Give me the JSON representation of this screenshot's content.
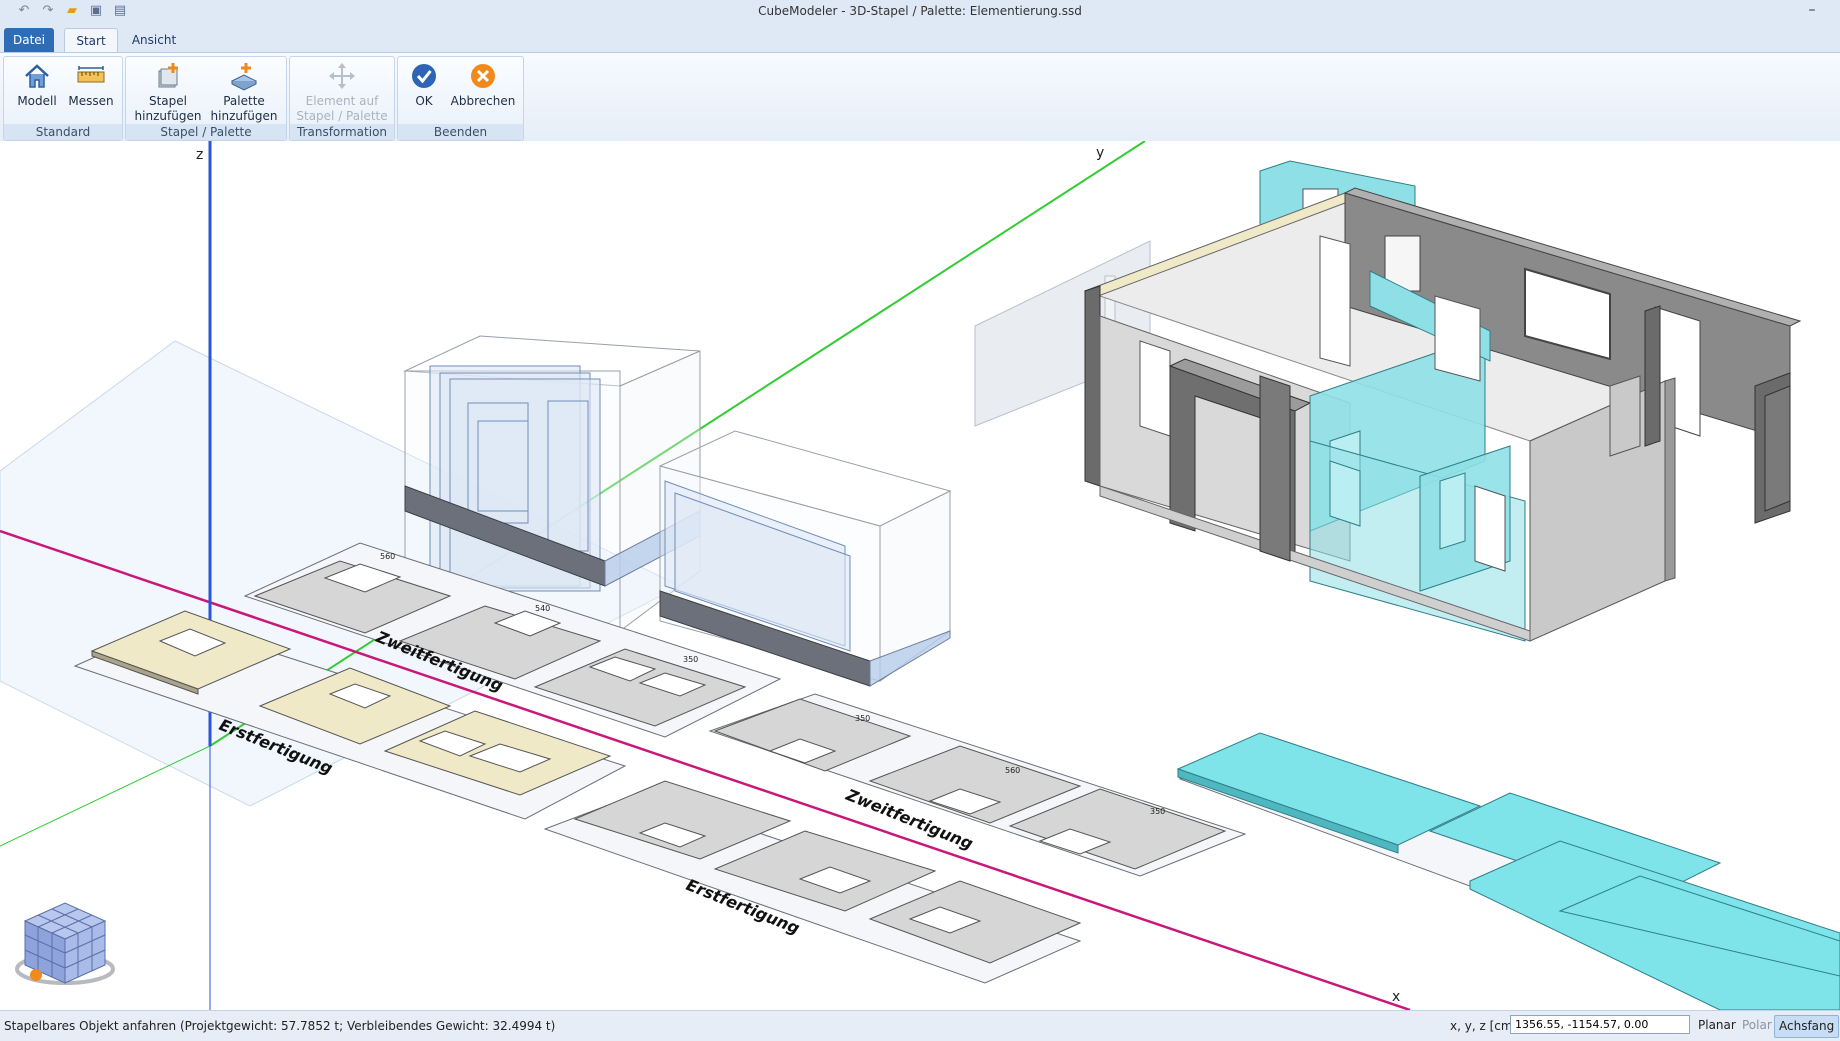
{
  "window": {
    "title": "CubeModeler - 3D-Stapel / Palette: Elementierung.ssd"
  },
  "tabs": [
    {
      "label": "Datei"
    },
    {
      "label": "Start"
    },
    {
      "label": "Ansicht"
    }
  ],
  "ribbon": {
    "groups": [
      {
        "label": "Standard",
        "buttons": [
          {
            "label": "Modell"
          },
          {
            "label": "Messen"
          }
        ]
      },
      {
        "label": "Stapel / Palette",
        "buttons": [
          {
            "label1": "Stapel",
            "label2": "hinzufügen"
          },
          {
            "label1": "Palette",
            "label2": "hinzufügen"
          }
        ]
      },
      {
        "label": "Transformation",
        "buttons": [
          {
            "label1": "Element auf",
            "label2": "Stapel / Palette"
          }
        ]
      },
      {
        "label": "Beenden",
        "buttons": [
          {
            "label": "OK"
          },
          {
            "label": "Abbrechen"
          }
        ]
      }
    ]
  },
  "viewport": {
    "axes": {
      "z": "z",
      "y": "y",
      "x": "x"
    },
    "pallet_labels": [
      "Erstfertigung",
      "Zweitfertigung",
      "Erstfertigung",
      "Zweitfertigung"
    ],
    "panel_tags": [
      "560",
      "540",
      "350",
      "350",
      "560",
      "350"
    ]
  },
  "status": {
    "message": "Stapelbares Objekt anfahren (Projektgewicht: 57.7852 t; Verbleibendes Gewicht: 32.4994 t)",
    "coord_label": "x, y, z [cm]",
    "coord_value": "1356.55, -1154.57, 0.00",
    "modes": {
      "planar": "Planar",
      "polar": "Polar",
      "achsfang": "Achsfang"
    }
  },
  "colors": {
    "accent": "#2e6db5",
    "ribbon_bg": "#e6eef8",
    "axis_x": "#c8187a",
    "axis_y": "#33cc33",
    "axis_z": "#2a55d6",
    "cyan_panel": "#7fe3ea",
    "cream_panel": "#efe9c8",
    "grey_panel": "#d4d4d4",
    "dark_wall": "#6b6b6b"
  },
  "icons": [
    "undo-icon",
    "redo-icon",
    "open-folder-icon",
    "save-icon",
    "save-as-icon",
    "home-icon",
    "ruler-icon",
    "add-stack-icon",
    "add-pallet-icon",
    "move-icon",
    "ok-icon",
    "cancel-icon",
    "view-cube-icon"
  ]
}
